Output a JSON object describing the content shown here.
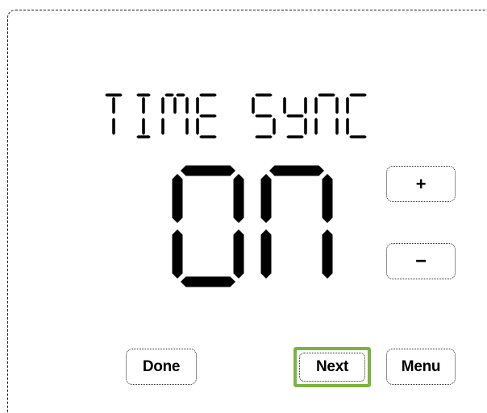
{
  "screen": {
    "title": "TIME SYNC",
    "value": "ON"
  },
  "buttons": {
    "increase_label": "+",
    "decrease_label": "−",
    "done_label": "Done",
    "next_label": "Next",
    "menu_label": "Menu"
  },
  "colors": {
    "background": "#ffffff",
    "segment": "#000000",
    "focus_highlight": "#7cb342"
  }
}
